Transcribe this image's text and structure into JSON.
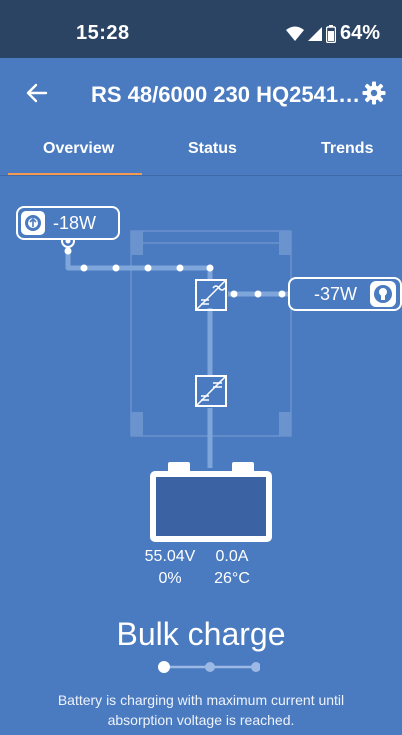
{
  "status_bar": {
    "time": "15:28",
    "battery_percent": "64%"
  },
  "app_bar": {
    "title": "RS 48/6000 230 HQ2541…"
  },
  "tabs": [
    {
      "label": "Overview",
      "active": true
    },
    {
      "label": "Status",
      "active": false
    },
    {
      "label": "Trends",
      "active": false
    }
  ],
  "diagram": {
    "input_power": "-18W",
    "output_power": "-37W"
  },
  "battery": {
    "voltage": "55.04V",
    "current": "0.0A",
    "soc": "0%",
    "temperature": "26°C"
  },
  "charge_state": {
    "label": "Bulk charge",
    "step_current": 1,
    "step_total": 3,
    "description": "Battery is charging with maximum current until absorption voltage is reached."
  },
  "colors": {
    "background": "#4a7ac0",
    "status_bar": "#2c4464",
    "accent": "#f39a55",
    "line": "#7fa6db"
  }
}
